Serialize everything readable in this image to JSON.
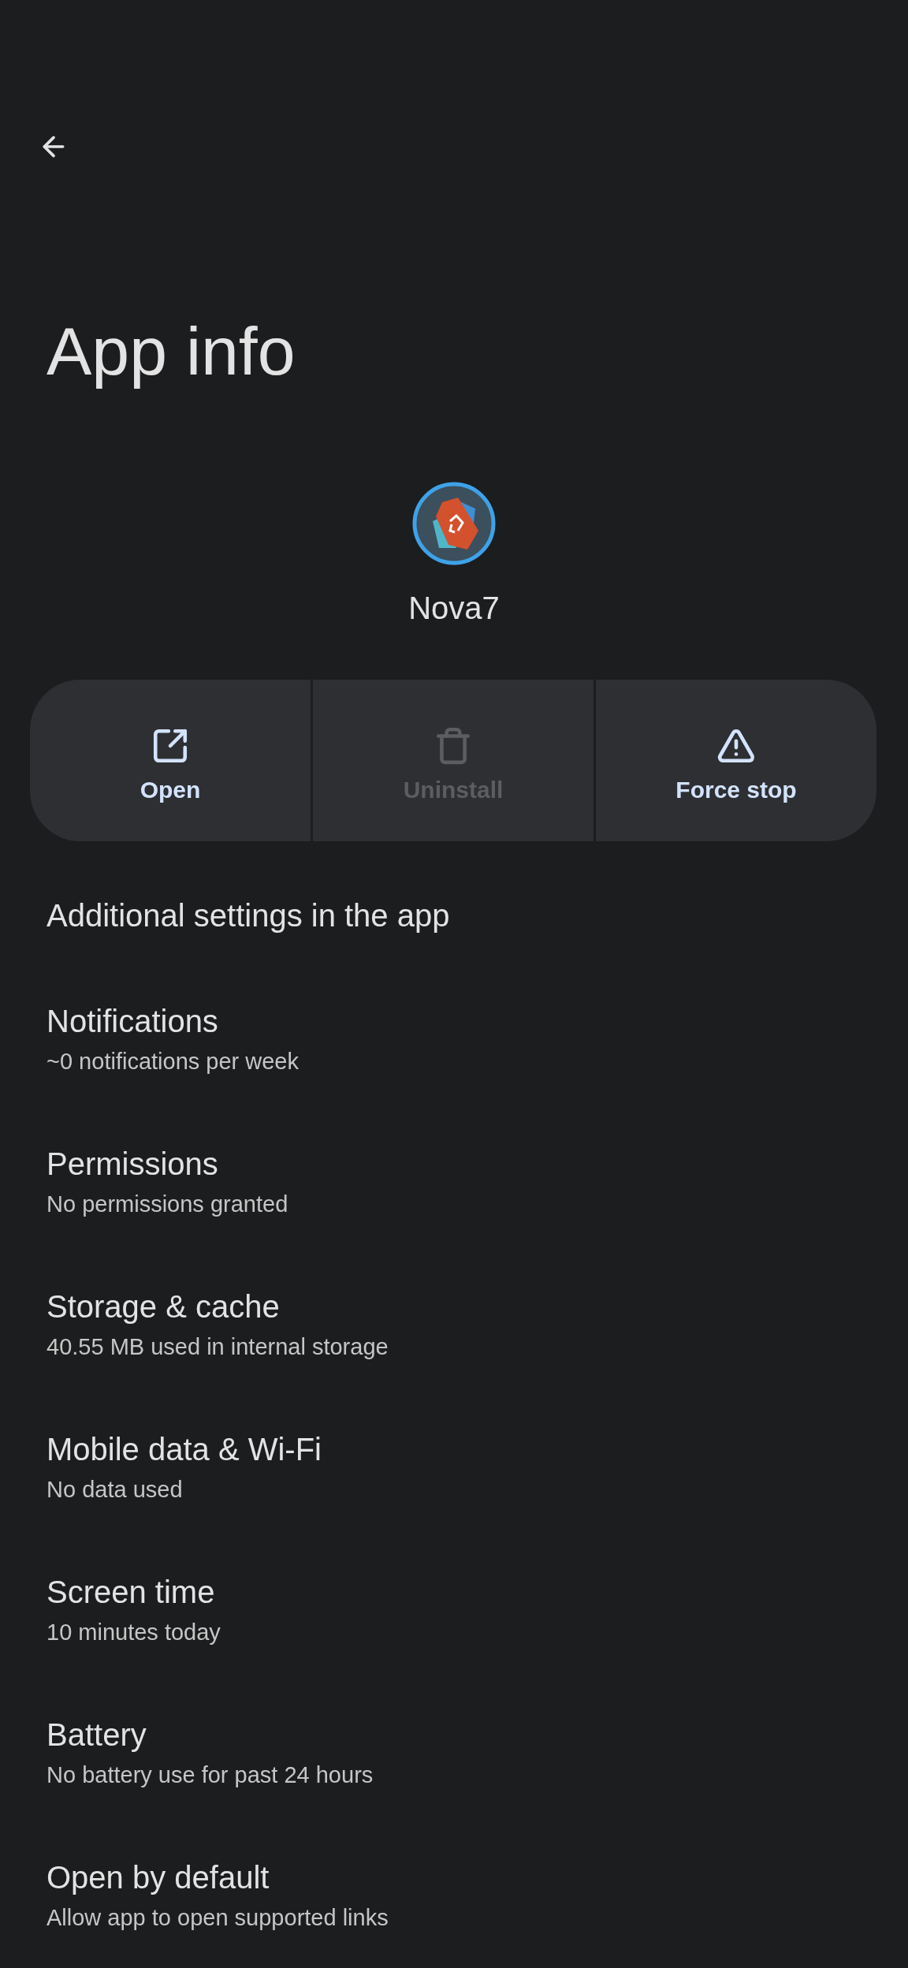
{
  "title": "App info",
  "app": {
    "name": "Nova7"
  },
  "actions": [
    {
      "kind": "open",
      "label": "Open",
      "disabled": false
    },
    {
      "kind": "uninstall",
      "label": "Uninstall",
      "disabled": true
    },
    {
      "kind": "force_stop",
      "label": "Force stop",
      "disabled": false
    }
  ],
  "settings": [
    {
      "title": "Additional settings in the app"
    },
    {
      "title": "Notifications",
      "summary": "~0 notifications per week"
    },
    {
      "title": "Permissions",
      "summary": "No permissions granted"
    },
    {
      "title": "Storage & cache",
      "summary": "40.55 MB used in internal storage"
    },
    {
      "title": "Mobile data & Wi‑Fi",
      "summary": "No data used"
    },
    {
      "title": "Screen time",
      "summary": "10 minutes today"
    },
    {
      "title": "Battery",
      "summary": "No battery use for past 24 hours"
    },
    {
      "title": "Open by default",
      "summary": "Allow app to open supported links"
    }
  ]
}
